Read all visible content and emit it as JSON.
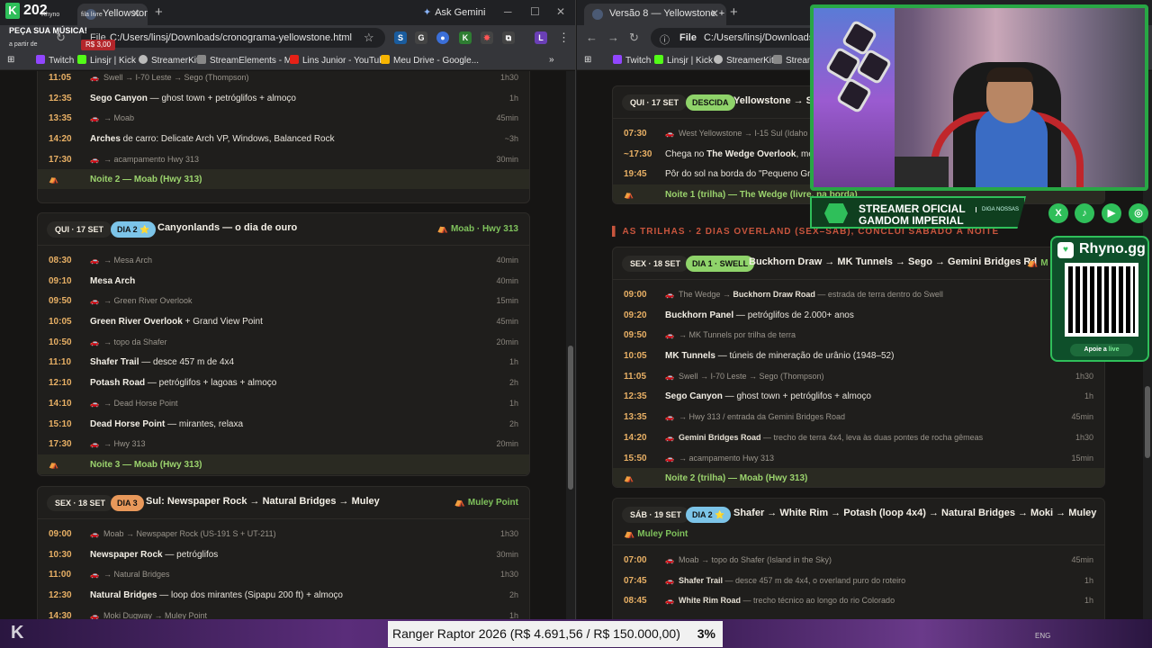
{
  "left": {
    "tabs": [
      {
        "label": "Yellowstone..."
      }
    ],
    "gemini_label": "Ask Gemini",
    "url": "C:/Users/linsj/Downloads/cronograma-yellowstone.html",
    "file_chip": "File",
    "bookmarks": [
      "Twitch",
      "Linsjr | Kick",
      "StreamerKit",
      "StreamElements - M...",
      "Lins Junior - YouTube",
      "Meu Drive - Google..."
    ],
    "card1": {
      "rows": [
        {
          "t": "11:05",
          "car": true,
          "d": "Swell → I-70 Leste → Sego (Thompson)",
          "dur": "1h30"
        },
        {
          "t": "12:35",
          "car": false,
          "b": "Sego Canyon",
          "d": " — ghost town + petróglifos + almoço",
          "dur": "1h"
        },
        {
          "t": "13:35",
          "car": true,
          "d": "→ Moab",
          "dur": "45min"
        },
        {
          "t": "14:20",
          "car": false,
          "b": "Arches",
          "d": " de carro: Delicate Arch VP, Windows, Balanced Rock",
          "dur": "~3h"
        },
        {
          "t": "17:30",
          "car": true,
          "d": "→ acampamento Hwy 313",
          "dur": "30min"
        }
      ],
      "night": "Noite 2 — Moab (Hwy 313)"
    },
    "card2": {
      "date": "QUI · 17 SET",
      "dia": "DIA 2 ⭐",
      "title": "Canyonlands — o dia de ouro",
      "tag": "Moab · Hwy 313",
      "rows": [
        {
          "t": "08:30",
          "car": true,
          "d": "→ Mesa Arch",
          "dur": "40min"
        },
        {
          "t": "09:10",
          "car": false,
          "b": "Mesa Arch",
          "d": "",
          "dur": "40min"
        },
        {
          "t": "09:50",
          "car": true,
          "d": "→ Green River Overlook",
          "dur": "15min"
        },
        {
          "t": "10:05",
          "car": false,
          "b": "Green River Overlook",
          "d": " + Grand View Point",
          "dur": "45min"
        },
        {
          "t": "10:50",
          "car": true,
          "d": "→ topo da Shafer",
          "dur": "20min"
        },
        {
          "t": "11:10",
          "car": false,
          "b": "Shafer Trail",
          "d": " — desce 457 m de 4x4",
          "dur": "1h"
        },
        {
          "t": "12:10",
          "car": false,
          "b": "Potash Road",
          "d": " — petróglifos + lagoas + almoço",
          "dur": "2h"
        },
        {
          "t": "14:10",
          "car": true,
          "d": "→ Dead Horse Point",
          "dur": "1h"
        },
        {
          "t": "15:10",
          "car": false,
          "b": "Dead Horse Point",
          "d": " — mirantes, relaxa",
          "dur": "2h"
        },
        {
          "t": "17:30",
          "car": true,
          "d": "→ Hwy 313",
          "dur": "20min"
        }
      ],
      "night": "Noite 3 — Moab (Hwy 313)"
    },
    "card3": {
      "date": "SEX · 18 SET",
      "dia": "DIA 3",
      "title": "Sul: Newspaper Rock → Natural Bridges → Muley",
      "tag": "Muley Point",
      "rows": [
        {
          "t": "09:00",
          "car": true,
          "d": "Moab → Newspaper Rock (US-191 S + UT-211)",
          "dur": "1h30"
        },
        {
          "t": "10:30",
          "car": false,
          "b": "Newspaper Rock",
          "d": " — petróglifos",
          "dur": "30min"
        },
        {
          "t": "11:00",
          "car": true,
          "d": "→ Natural Bridges",
          "dur": "1h30"
        },
        {
          "t": "12:30",
          "car": false,
          "b": "Natural Bridges",
          "d": " — loop dos mirantes (Sipapu 200 ft) + almoço",
          "dur": "2h"
        },
        {
          "t": "14:30",
          "car": true,
          "d": "Moki Dugway → Muley Point",
          "dur": "1h"
        }
      ]
    }
  },
  "right": {
    "tabs": [
      {
        "label": "Versão 8 — Yellowstone + 2 dia..."
      }
    ],
    "url": "C:/Users/linsj/Downloads/cronog",
    "file_chip": "File",
    "bookmarks": [
      "Twitch",
      "Linsjr | Kick",
      "StreamerKit",
      "Stream"
    ],
    "card1": {
      "date": "QUI · 17 SET",
      "dia": "DESCIDA",
      "title": "Yellowstone → San",
      "rows": [
        {
          "t": "07:30",
          "car": true,
          "d": "West Yellowstone → I-15 Sul (Idaho Fa",
          "dur": ""
        },
        {
          "t": "~17:30",
          "car": false,
          "pre": "Chega no ",
          "b": "The Wedge Overlook",
          "d": ", mont",
          "dur": ""
        },
        {
          "t": "19:45",
          "car": false,
          "pre": "Pôr do sol na borda do \"Pequeno Gran",
          "b": "",
          "d": "",
          "dur": ""
        }
      ],
      "night": "Noite 1 (trilha) — The Wedge (livre, na borda)"
    },
    "section": "AS TRILHAS · 2 DIAS OVERLAND (SEX–SÁB), CONCLUI SÁBADO À NOITE",
    "card2": {
      "date": "SEX · 18 SET",
      "dia": "DIA 1 · SWELL",
      "title": "Buckhorn Draw → MK Tunnels → Sego → Gemini Bridges Rd",
      "tag": "M",
      "rows": [
        {
          "t": "09:00",
          "car": true,
          "d": "The Wedge → ",
          "b2": "Buckhorn Draw Road",
          "d2": " — estrada de terra dentro do Swell",
          "dur": ""
        },
        {
          "t": "09:20",
          "car": false,
          "b": "Buckhorn Panel",
          "d": " — petróglifos de 2.000+ anos",
          "dur": ""
        },
        {
          "t": "09:50",
          "car": true,
          "d": "→ MK Tunnels por trilha de terra",
          "dur": ""
        },
        {
          "t": "10:05",
          "car": false,
          "b": "MK Tunnels",
          "d": " — túneis de mineração de urânio (1948–52)",
          "dur": ""
        },
        {
          "t": "11:05",
          "car": true,
          "d": "Swell → I-70 Leste → Sego (Thompson)",
          "dur": "1h30"
        },
        {
          "t": "12:35",
          "car": false,
          "b": "Sego Canyon",
          "d": " — ghost town + petróglifos + almoço",
          "dur": "1h"
        },
        {
          "t": "13:35",
          "car": true,
          "d": "→ Hwy 313 / entrada da Gemini Bridges Road",
          "dur": "45min"
        },
        {
          "t": "14:20",
          "car": true,
          "b2": "Gemini Bridges Road",
          "d": "",
          "d2": " — trecho de terra 4x4, leva às duas pontes de rocha gêmeas",
          "dur": "1h30"
        },
        {
          "t": "15:50",
          "car": true,
          "d": "→ acampamento Hwy 313",
          "dur": "15min"
        }
      ],
      "night": "Noite 2 (trilha) — Moab (Hwy 313)"
    },
    "card3": {
      "date": "SÁB · 19 SET",
      "dia": "DIA 2 ⭐",
      "title": "Shafer → White Rim → Potash (loop 4x4) → Natural Bridges → Moki → Muley",
      "tag": "Muley Point",
      "rows": [
        {
          "t": "07:00",
          "car": true,
          "d": "Moab → topo do Shafer (Island in the Sky)",
          "dur": "45min"
        },
        {
          "t": "07:45",
          "car": true,
          "b2": "Shafer Trail",
          "d": "",
          "d2": " — desce 457 m de 4x4, o overland puro do roteiro",
          "dur": "1h"
        },
        {
          "t": "08:45",
          "car": true,
          "b2": "White Rim Road",
          "d": "",
          "d2": " — trecho técnico ao longo do rio Colorado",
          "dur": "1h"
        }
      ]
    }
  },
  "overlay": {
    "count": "202",
    "small1": "Rhyno",
    "small2": "fila livre",
    "peca": "PEÇA SUA MÚSICA!",
    "apartir": "a partir de",
    "price": "R$ 3,00",
    "banner_l1": "STREAMER OFICIAL",
    "banner_l2": "GAMDOM IMPERIAL",
    "banner_l3": "DIGA NOSSAS",
    "rhyno": "Rhyno.gg",
    "apoie": "Apoie a",
    "apoie2": "live",
    "ranger": "Ranger Raptor 2026 (R$ 4.691,56 / R$ 150.000,00)",
    "ranger_pct": "3%"
  },
  "colors": {
    "accent_orange": "#e8b065",
    "night_green": "#9bd36d",
    "dia_blue": "#7cc4e8",
    "dia_orange": "#e8985a",
    "dia_green": "#8fd36a",
    "descida_green": "#8fd36a",
    "section_red": "#c8553d"
  }
}
